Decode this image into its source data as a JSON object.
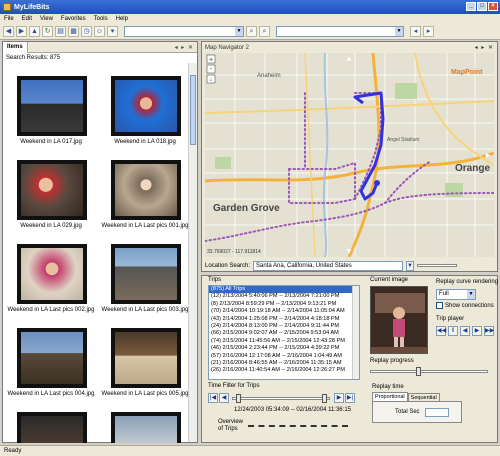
{
  "window": {
    "title": "MyLifeBits"
  },
  "menu": [
    "File",
    "Edit",
    "View",
    "Favorites",
    "Tools",
    "Help"
  ],
  "items_panel": {
    "tab_label": "Items",
    "search_results": "Search Results: 875",
    "thumbnails": [
      {
        "caption": "Weekend in LA 017.jpg"
      },
      {
        "caption": "Weekend in LA 018.jpg"
      },
      {
        "caption": "Weekend in LA 029.jpg"
      },
      {
        "caption": "Weekend in LA Last pics 001.jpg"
      },
      {
        "caption": "Weekend in LA Last pics 002.jpg"
      },
      {
        "caption": "Weekend in LA Last pics 003.jpg"
      },
      {
        "caption": "Weekend in LA Last pics 004.jpg"
      },
      {
        "caption": "Weekend in LA Last pics 005.jpg"
      }
    ]
  },
  "map_panel": {
    "title": "Map Navigator 2",
    "labels": {
      "garden_grove": "Garden Grove",
      "orange": "Orange",
      "mappoint": "MapPoint",
      "anaheim": "Anaheim",
      "angel_stadium": "Angel Stadium",
      "coords": "33.769027 - 117.911814"
    },
    "location_label": "Location Search:",
    "location_value": "Santa Ana, California, United States"
  },
  "trips": {
    "label": "Trips",
    "items": [
      "(875) All Trips",
      "(12) 2/13/2004 5:40:06 PM -- 2/13/2004 7:21:00 PM",
      "(8) 2/13/2004 8:59:29 PM -- 2/13/2004 9:13:21 PM",
      "(70) 2/14/2004 10:19:18 AM -- 2/14/2004 11:05:04 AM",
      "(43) 2/14/2004 1:25:08 PM -- 2/14/2004 4:18:18 PM",
      "(24) 2/14/2004 8:13:00 PM -- 2/14/2004 9:11:44 PM",
      "(66) 2/15/2004 9:02:07 AM -- 2/15/2004 9:53:04 AM",
      "(74) 2/15/2004 11:45:56 AM -- 2/15/2004 12:43:28 PM",
      "(46) 2/15/2004 2:23:44 PM -- 2/15/2004 4:39:22 PM",
      "(57) 2/16/2004 12:17:08 AM -- 2/16/2004 1:04:49 AM",
      "(21) 2/16/2004 8:46:55 AM -- 2/16/2004 11:35:15 AM",
      "(26) 2/16/2004 11:40:54 AM -- 2/16/2004 12:26:27 PM"
    ],
    "selected_index": 0,
    "time_filter_label": "Time Filter for Trips",
    "range_text": "12/24/2003 05:34:09 -- 02/16/2004 11:36:15",
    "overview_label_1": "Overview",
    "overview_label_2": "of Trips"
  },
  "current_image": {
    "label": "Current image"
  },
  "replay": {
    "curve_label": "Replay curve rendering",
    "curve_value": "Full",
    "show_connections": "Show connections",
    "trip_player_label": "Trip player",
    "progress_label": "Replay progress",
    "time_label": "Replay time",
    "tab_proportional": "Proportional",
    "tab_sequential": "Sequential",
    "total_sec_label": "Total Sec"
  },
  "status": {
    "text": "Ready"
  },
  "colors": {
    "title_bar": "#2457c5",
    "trip_path": "#3333dd",
    "trip_dots": "#9b59b6",
    "selection": "#316ac5"
  }
}
